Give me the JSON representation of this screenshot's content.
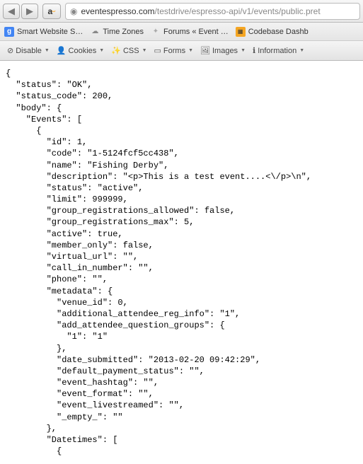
{
  "url": {
    "prefix": "",
    "host": "eventespresso.com",
    "path": "/testdrive/espresso-api/v1/events/public.pret"
  },
  "nav": {
    "back": "◀",
    "forward": "▶",
    "amazon": "a"
  },
  "bookmarks": {
    "b1": "Smart Website S…",
    "b2": "Time Zones",
    "b3": "Forums « Event …",
    "b4": "Codebase Dashb"
  },
  "devtools": {
    "disable": "Disable",
    "cookies": "Cookies",
    "css": "CSS",
    "forms": "Forms",
    "images": "Images",
    "info": "Information"
  },
  "json_text": "{\n  \"status\": \"OK\",\n  \"status_code\": 200,\n  \"body\": {\n    \"Events\": [\n      {\n        \"id\": 1,\n        \"code\": \"1-5124fcf5cc438\",\n        \"name\": \"Fishing Derby\",\n        \"description\": \"<p>This is a test event....<\\/p>\\n\",\n        \"status\": \"active\",\n        \"limit\": 999999,\n        \"group_registrations_allowed\": false,\n        \"group_registrations_max\": 5,\n        \"active\": true,\n        \"member_only\": false,\n        \"virtual_url\": \"\",\n        \"call_in_number\": \"\",\n        \"phone\": \"\",\n        \"metadata\": {\n          \"venue_id\": 0,\n          \"additional_attendee_reg_info\": \"1\",\n          \"add_attendee_question_groups\": {\n            \"1\": \"1\"\n          },\n          \"date_submitted\": \"2013-02-20 09:42:29\",\n          \"default_payment_status\": \"\",\n          \"event_hashtag\": \"\",\n          \"event_format\": \"\",\n          \"event_livestreamed\": \"\",\n          \"_empty_\": \"\"\n        },\n        \"Datetimes\": [\n          {"
}
